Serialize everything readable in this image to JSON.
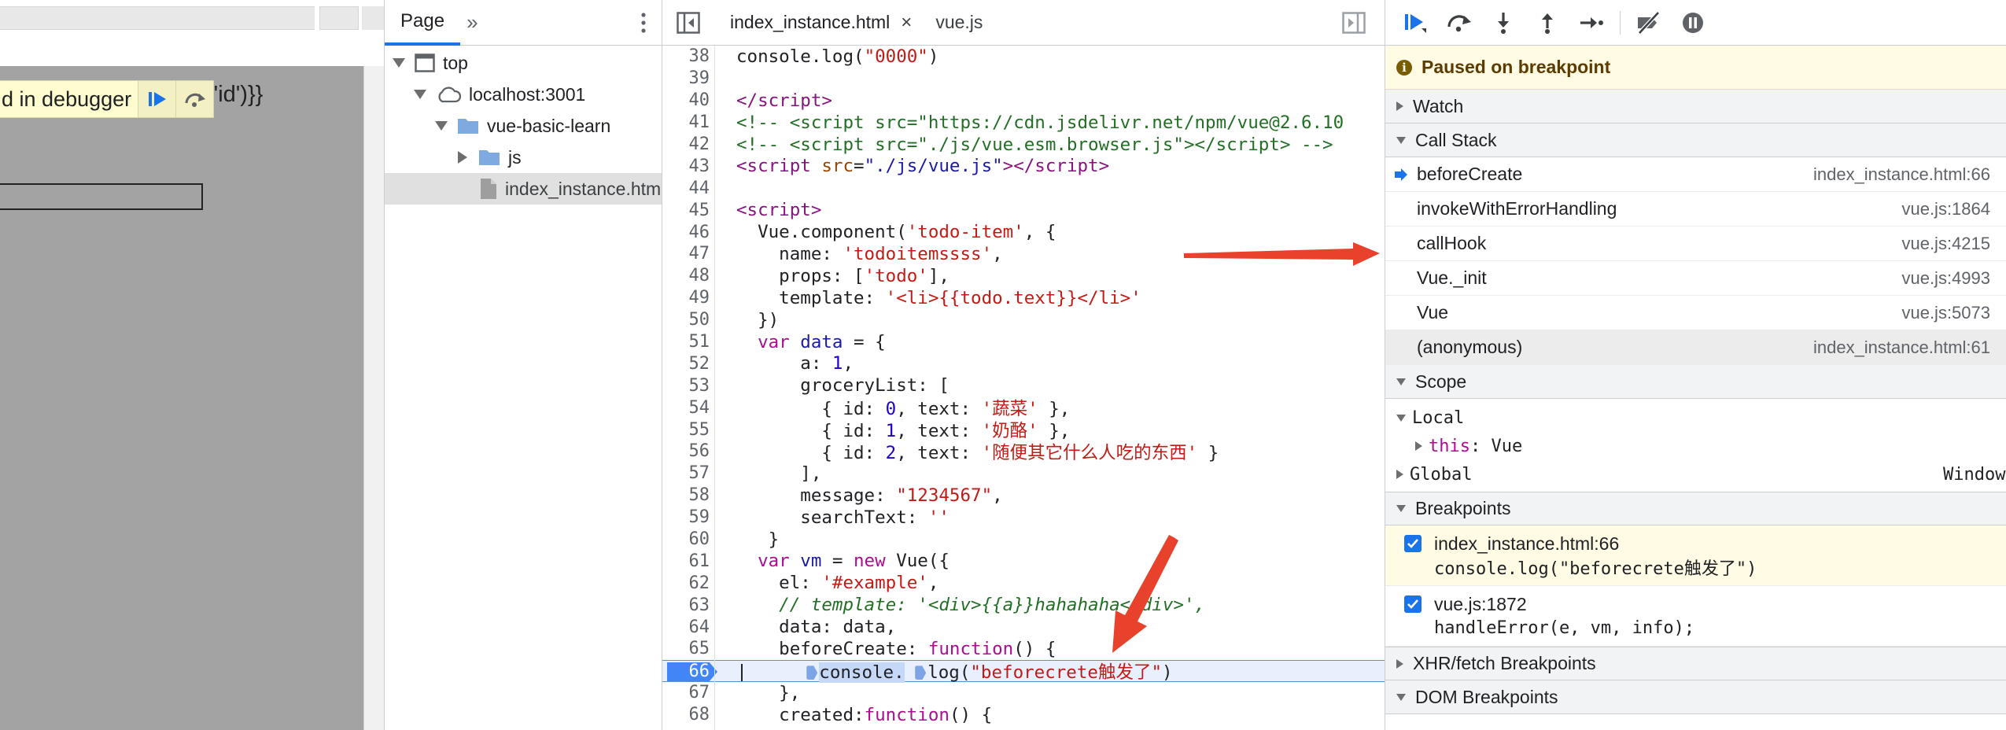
{
  "preview": {
    "paused_text": "d in debugger",
    "template_text": "('id')}}"
  },
  "navigator": {
    "tab_label": "Page",
    "more_label": "»",
    "tree": [
      {
        "label": "top",
        "depth": 0,
        "icon": "frame-icon",
        "expanded": true
      },
      {
        "label": "localhost:3001",
        "depth": 1,
        "icon": "cloud-icon",
        "expanded": true
      },
      {
        "label": "vue-basic-learn",
        "depth": 2,
        "icon": "folder-icon",
        "expanded": true
      },
      {
        "label": "js",
        "depth": 3,
        "icon": "folder-icon",
        "expanded": false
      },
      {
        "label": "index_instance.htm",
        "depth": 3,
        "icon": "file-icon",
        "selected": true
      }
    ]
  },
  "editor": {
    "tabs": [
      {
        "label": "index_instance.html",
        "active": true,
        "close": "×"
      },
      {
        "label": "vue.js",
        "active": false
      }
    ],
    "breakpoint_line": 66,
    "lines": [
      {
        "n": 38,
        "html": "console.log(<span class=\"c-str\">\"0000\"</span>)"
      },
      {
        "n": 39,
        "html": ""
      },
      {
        "n": 40,
        "html": "<span class=\"c-tag\">&lt;/script&gt;</span>"
      },
      {
        "n": 41,
        "html": "<span class=\"c-html-com\">&lt;!-- &lt;script src=\"https://cdn.jsdelivr.net/npm/vue@2.6.10</span>"
      },
      {
        "n": 42,
        "html": "<span class=\"c-html-com\">&lt;!-- &lt;script src=\"./js/vue.esm.browser.js\"&gt;&lt;/script&gt; --&gt;</span>"
      },
      {
        "n": 43,
        "html": "<span class=\"c-tag\">&lt;script</span> <span class=\"c-attr\">src</span>=<span class=\"c-var\">\"./js/vue.js\"</span><span class=\"c-tag\">&gt;&lt;/script&gt;</span>"
      },
      {
        "n": 44,
        "html": ""
      },
      {
        "n": 45,
        "html": "<span class=\"c-tag\">&lt;script&gt;</span>"
      },
      {
        "n": 46,
        "html": "  Vue.component(<span class=\"c-str\">'todo-item'</span>, {"
      },
      {
        "n": 47,
        "html": "    name: <span class=\"c-str\">'todoitemssss'</span>,"
      },
      {
        "n": 48,
        "html": "    props: [<span class=\"c-str\">'todo'</span>],"
      },
      {
        "n": 49,
        "html": "    template: <span class=\"c-str\">'&lt;li&gt;{{todo.text}}&lt;/li&gt;'</span>"
      },
      {
        "n": 50,
        "html": "  })"
      },
      {
        "n": 51,
        "html": "  <span class=\"c-kw\">var</span> <span class=\"c-var\">data</span> = {"
      },
      {
        "n": 52,
        "html": "      a: <span class=\"c-num\">1</span>,"
      },
      {
        "n": 53,
        "html": "      groceryList: ["
      },
      {
        "n": 54,
        "html": "        { id: <span class=\"c-num\">0</span>, text: <span class=\"c-str\">'蔬菜'</span> },"
      },
      {
        "n": 55,
        "html": "        { id: <span class=\"c-num\">1</span>, text: <span class=\"c-str\">'奶酪'</span> },"
      },
      {
        "n": 56,
        "html": "        { id: <span class=\"c-num\">2</span>, text: <span class=\"c-str\">'随便其它什么人吃的东西'</span> }"
      },
      {
        "n": 57,
        "html": "      ],"
      },
      {
        "n": 58,
        "html": "      message: <span class=\"c-str\">\"1234567\"</span>,"
      },
      {
        "n": 59,
        "html": "      searchText: <span class=\"c-str\">''</span>"
      },
      {
        "n": 60,
        "html": "   }"
      },
      {
        "n": 61,
        "html": "  <span class=\"c-kw\">var</span> <span class=\"c-var\">vm</span> = <span class=\"c-kw\">new</span> Vue({"
      },
      {
        "n": 62,
        "html": "    el: <span class=\"c-str\">'#example'</span>,"
      },
      {
        "n": 63,
        "html": "    <span class=\"c-com\">// template: '&lt;div&gt;{{a}}hahahaha&lt;/div&gt;',</span>"
      },
      {
        "n": 64,
        "html": "    data: data,"
      },
      {
        "n": 65,
        "html": "    beforeCreate: <span class=\"c-kw\">function</span>() {"
      },
      {
        "n": 66,
        "html": "      <span class=\"inl-bp\"></span><span class=\"hl-sel\">console.</span> <span class=\"inl-bp\"></span>log(<span class=\"c-str\">\"beforecrete触发了\"</span>)"
      },
      {
        "n": 67,
        "html": "    },"
      },
      {
        "n": 68,
        "html": "    created:<span class=\"c-kw\">function</span>() {"
      }
    ]
  },
  "debugger": {
    "paused_message": "Paused on breakpoint",
    "info_glyph": "i",
    "sections": {
      "watch": "Watch",
      "call_stack": "Call Stack",
      "scope": "Scope",
      "breakpoints": "Breakpoints",
      "xhr": "XHR/fetch Breakpoints",
      "dom": "DOM Breakpoints"
    },
    "call_stack": [
      {
        "fn": "beforeCreate",
        "loc": "index_instance.html:66",
        "current": true
      },
      {
        "fn": "invokeWithErrorHandling",
        "loc": "vue.js:1864"
      },
      {
        "fn": "callHook",
        "loc": "vue.js:4215"
      },
      {
        "fn": "Vue._init",
        "loc": "vue.js:4993"
      },
      {
        "fn": "Vue",
        "loc": "vue.js:5073"
      },
      {
        "fn": "(anonymous)",
        "loc": "index_instance.html:61",
        "hover": true
      }
    ],
    "scope": {
      "local_label": "Local",
      "this_key": "this",
      "this_value": ": Vue",
      "global_label": "Global",
      "global_value": "Window"
    },
    "breakpoints": [
      {
        "location": "index_instance.html:66",
        "code": "console.log(\"beforecrete触发了\")",
        "active": true
      },
      {
        "location": "vue.js:1872",
        "code": "handleError(e, vm, info);",
        "active": false
      }
    ]
  },
  "colors": {
    "accent": "#1a73e8",
    "paused_bg": "#fffbe5",
    "arrow": "#e8412c"
  }
}
